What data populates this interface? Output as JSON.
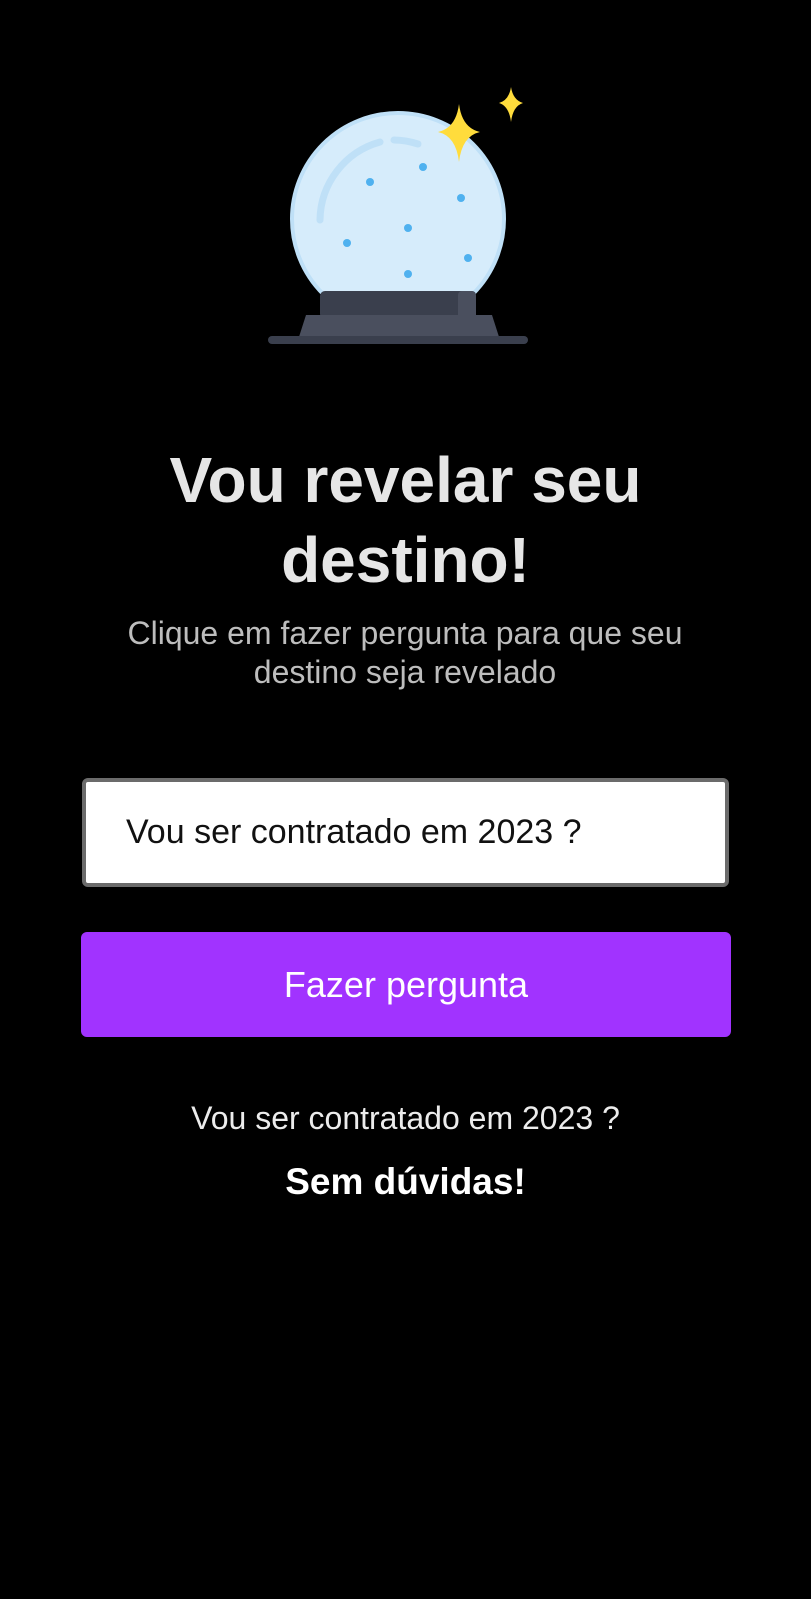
{
  "hero": {
    "icon": "crystal-ball-icon",
    "sparkle_icon": "sparkle-icon",
    "colors": {
      "globe": "#d6ecfb",
      "globe_stroke": "#bfe0f7",
      "dots": "#4fb1ef",
      "base": "#3a3f4d",
      "base_light": "#4a4f5e",
      "sparkle": "#ffdc3c"
    }
  },
  "header": {
    "title_line1": "Vou revelar seu",
    "title_line2": "destino!",
    "subtitle": "Clique em fazer pergunta para que seu destino seja revelado"
  },
  "form": {
    "question_value": "Vou ser contratado em 2023 ?",
    "question_placeholder": "",
    "ask_button_label": "Fazer pergunta"
  },
  "result": {
    "question": "Vou ser contratado em 2023 ?",
    "answer": "Sem dúvidas!"
  },
  "theme": {
    "background": "#000000",
    "accent": "#a133ff"
  }
}
